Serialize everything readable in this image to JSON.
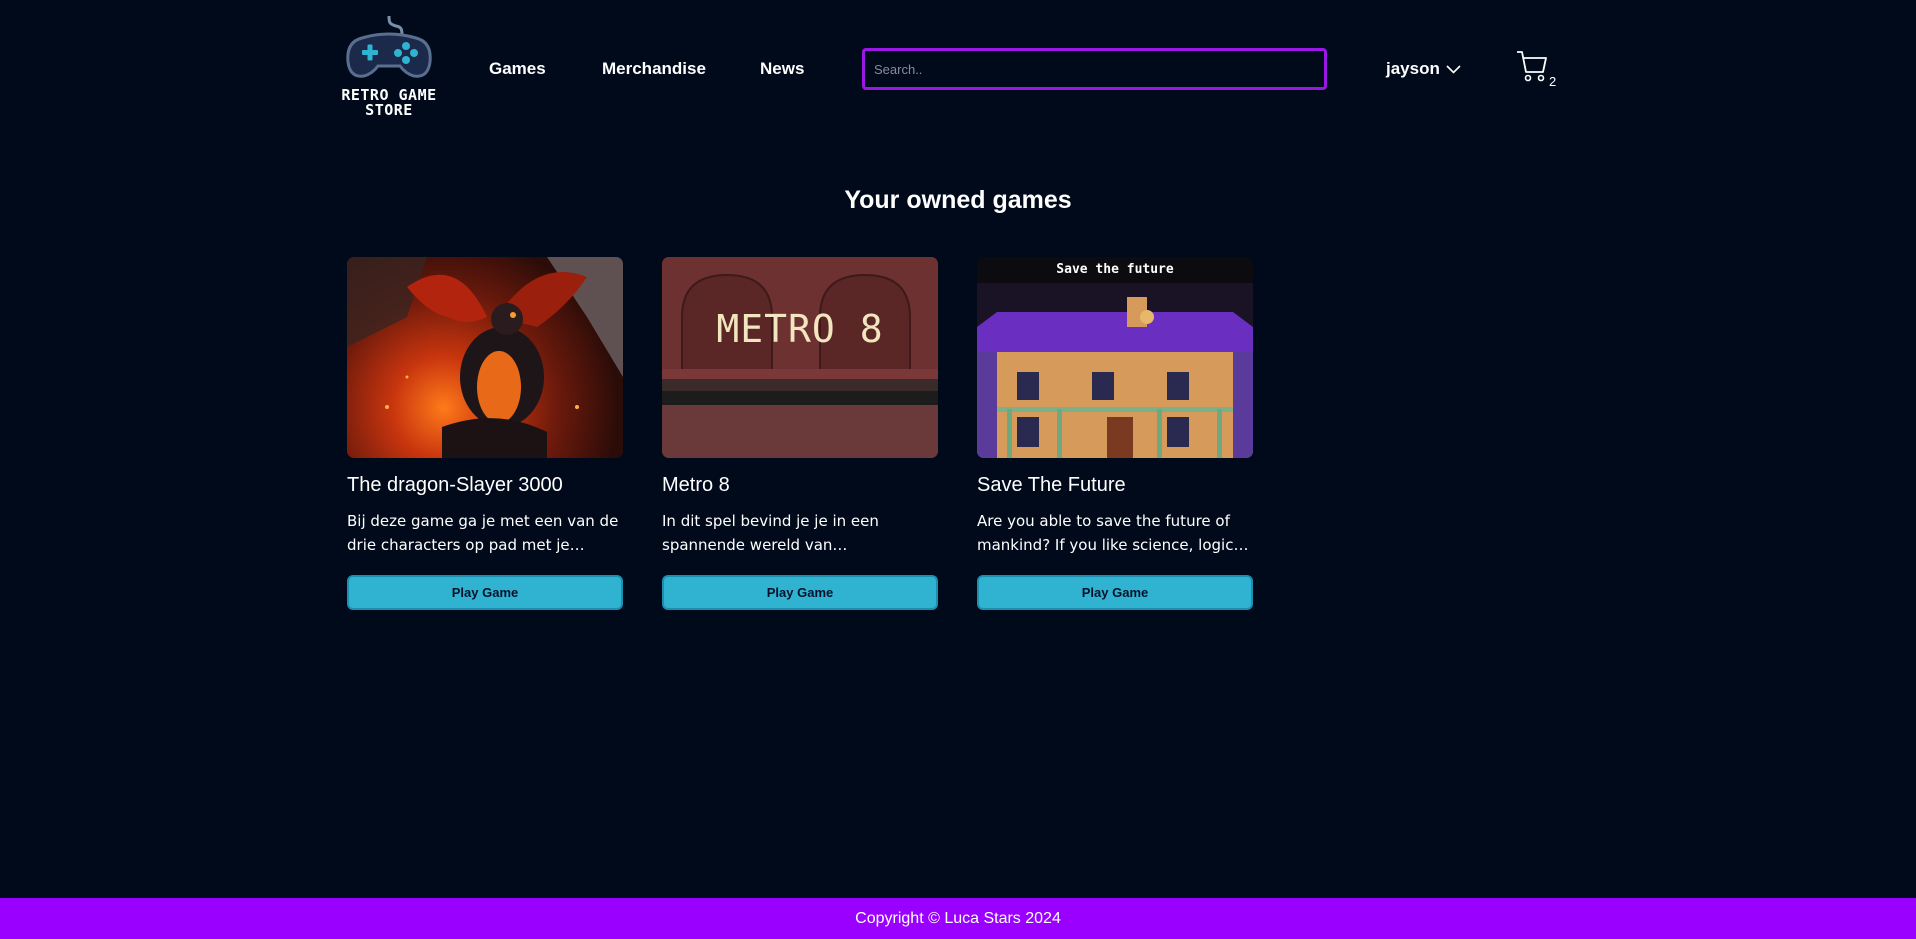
{
  "header": {
    "logo_text": "Retro Game Store",
    "nav": [
      "Games",
      "Merchandise",
      "News"
    ],
    "search": {
      "placeholder": "Search..",
      "value": ""
    },
    "user": {
      "name": "jayson",
      "icon": "chevron-down-icon"
    },
    "cart": {
      "icon": "cart-icon",
      "count": "2"
    }
  },
  "main": {
    "title": "Your owned games",
    "cards": [
      {
        "title": "The dragon-Slayer 3000",
        "description": "Bij deze game ga je met een van de drie characters op pad met je partner om de draak te verslaan.",
        "button": "Play Game",
        "image_caption": ""
      },
      {
        "title": "Metro 8",
        "description": "In dit spel bevind je je in een spannende wereld van ondergrondse metrostations.",
        "button": "Play Game",
        "image_caption": "METRO 8"
      },
      {
        "title": "Save The Future",
        "description": "Are you able to save the future of mankind? If you like science, logical puzzles and adventure.",
        "button": "Play Game",
        "image_caption": "Save the future"
      }
    ]
  },
  "footer": {
    "text": "Copyright © Luca Stars 2024"
  },
  "colors": {
    "background": "#000a1b",
    "accent": "#9900ff",
    "search_border": "#9a17e6",
    "button": "#2fb3d1"
  }
}
